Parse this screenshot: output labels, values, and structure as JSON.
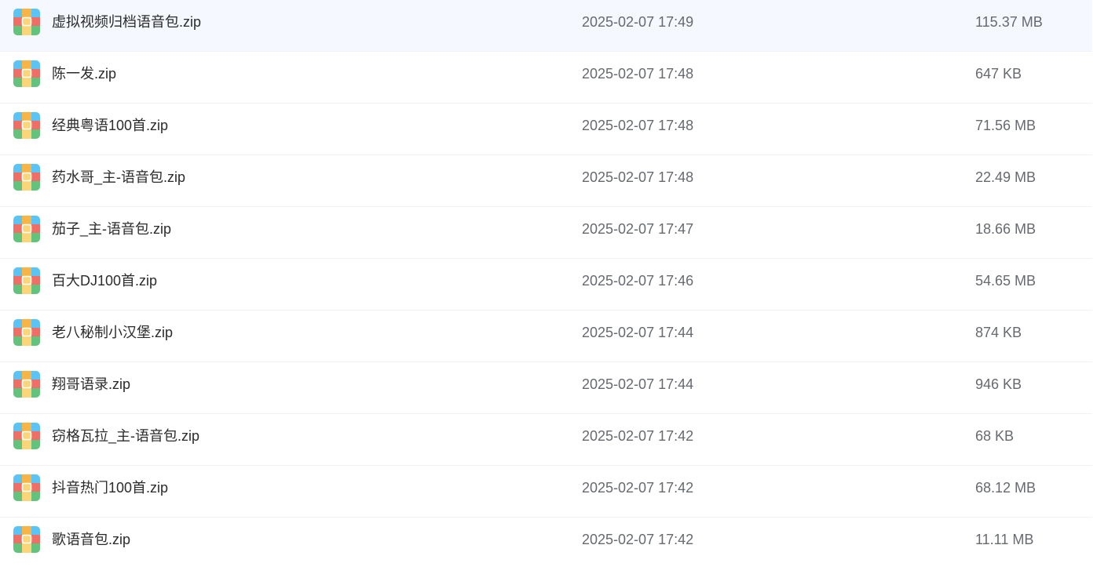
{
  "files": [
    {
      "name": "虚拟视频归档语音包.zip",
      "modified": "2025-02-07 17:49",
      "size": "115.37 MB",
      "icon": "zip-file-icon"
    },
    {
      "name": "陈一发.zip",
      "modified": "2025-02-07 17:48",
      "size": "647 KB",
      "icon": "zip-file-icon"
    },
    {
      "name": "经典粤语100首.zip",
      "modified": "2025-02-07 17:48",
      "size": "71.56 MB",
      "icon": "zip-file-icon"
    },
    {
      "name": "药水哥_主-语音包.zip",
      "modified": "2025-02-07 17:48",
      "size": "22.49 MB",
      "icon": "zip-file-icon"
    },
    {
      "name": "茄子_主-语音包.zip",
      "modified": "2025-02-07 17:47",
      "size": "18.66 MB",
      "icon": "zip-file-icon"
    },
    {
      "name": "百大DJ100首.zip",
      "modified": "2025-02-07 17:46",
      "size": "54.65 MB",
      "icon": "zip-file-icon"
    },
    {
      "name": "老八秘制小汉堡.zip",
      "modified": "2025-02-07 17:44",
      "size": "874 KB",
      "icon": "zip-file-icon"
    },
    {
      "name": "翔哥语录.zip",
      "modified": "2025-02-07 17:44",
      "size": "946 KB",
      "icon": "zip-file-icon"
    },
    {
      "name": "窃格瓦拉_主-语音包.zip",
      "modified": "2025-02-07 17:42",
      "size": "68 KB",
      "icon": "zip-file-icon"
    },
    {
      "name": "抖音热门100首.zip",
      "modified": "2025-02-07 17:42",
      "size": "68.12 MB",
      "icon": "zip-file-icon"
    },
    {
      "name": "歌语音包.zip",
      "modified": "2025-02-07 17:42",
      "size": "11.11 MB",
      "icon": "zip-file-icon"
    }
  ],
  "colors": {
    "icon_blue": "#5bc4f5",
    "icon_orange": "#f7b548",
    "icon_red": "#ef6f67",
    "icon_yellow": "#fbd57a",
    "icon_green": "#63c37d",
    "row_divider": "#f1f2f4",
    "name_text": "#2b2b2b",
    "meta_text": "#666a70"
  }
}
